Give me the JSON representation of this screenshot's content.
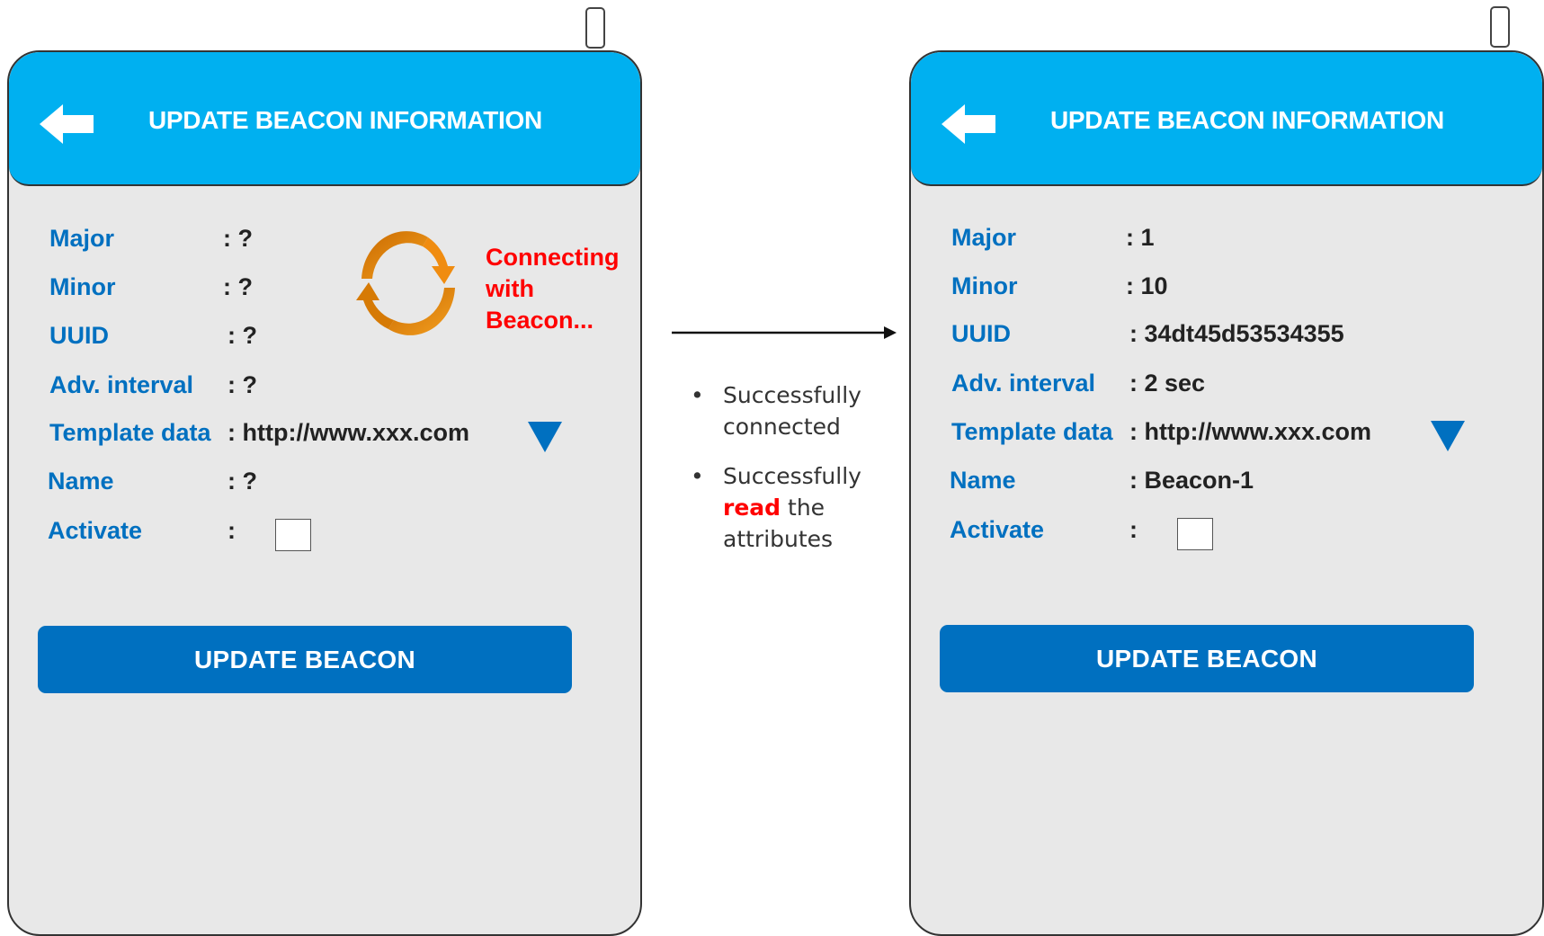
{
  "left_screen": {
    "title": "UPDATE BEACON INFORMATION",
    "fields": [
      {
        "label": "Major",
        "value": ": ?"
      },
      {
        "label": "Minor",
        "value": ": ?"
      },
      {
        "label": "UUID",
        "value": ": ?"
      },
      {
        "label": "Adv. interval",
        "value": ": ?"
      },
      {
        "label": "Template data",
        "value": ": http://www.xxx.com"
      },
      {
        "label": "Name",
        "value": ": ?"
      },
      {
        "label": "Activate",
        "value": ":"
      }
    ],
    "status_lines": [
      "Connecting",
      "with",
      "Beacon..."
    ],
    "button_label": "UPDATE BEACON",
    "activate_checked": false
  },
  "right_screen": {
    "title": "UPDATE BEACON INFORMATION",
    "fields": [
      {
        "label": "Major",
        "value": ": 1"
      },
      {
        "label": "Minor",
        "value": ": 10"
      },
      {
        "label": "UUID",
        "value": ": 34dt45d53534355"
      },
      {
        "label": "Adv. interval",
        "value": ": 2 sec"
      },
      {
        "label": "Template data",
        "value": ": http://www.xxx.com"
      },
      {
        "label": "Name",
        "value": ": Beacon-1"
      },
      {
        "label": "Activate",
        "value": ":"
      }
    ],
    "button_label": "UPDATE BEACON",
    "activate_checked": false
  },
  "notes": {
    "bullet": "•",
    "item1": "Successfully connected",
    "item2_highlight": "read",
    "item2_pre": "Successfully",
    "item2_post": "the attributes"
  },
  "colors": {
    "header": "#00b0f0",
    "label": "#0070c0",
    "button": "#0070c0",
    "status": "#ff0000",
    "spinner": "#e88a10"
  },
  "icons": {
    "back": "back-arrow-icon",
    "dropdown": "dropdown-triangle-icon",
    "spinner": "refresh-spinner-icon"
  }
}
